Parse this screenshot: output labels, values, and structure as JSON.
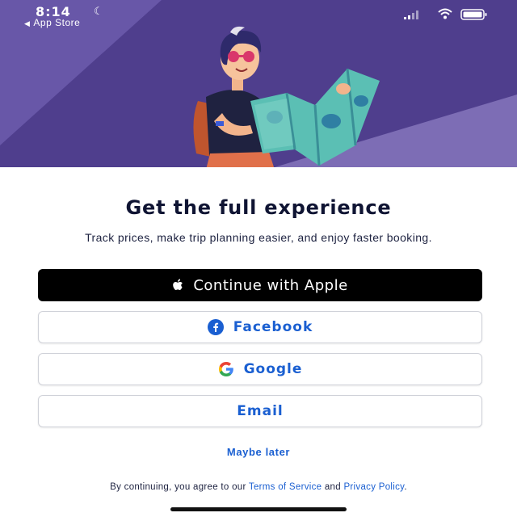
{
  "status_bar": {
    "time": "8:14",
    "moon_icon": "moon-icon",
    "back_app": "App Store",
    "icons": [
      "signal-icon",
      "wifi-icon",
      "battery-icon"
    ]
  },
  "hero": {
    "illustration": "traveler-with-map-illustration",
    "colors": {
      "background": "#4f3e8d",
      "accent_light": "#6857a8"
    }
  },
  "content": {
    "title": "Get the full experience",
    "subtitle": "Track prices, make trip planning easier, and enjoy faster booking."
  },
  "buttons": {
    "apple": {
      "label": "Continue with Apple",
      "icon": "apple-logo-icon"
    },
    "facebook": {
      "label": "Facebook",
      "icon": "facebook-logo-icon"
    },
    "google": {
      "label": "Google",
      "icon": "google-logo-icon"
    },
    "email": {
      "label": "Email"
    }
  },
  "maybe_later": "Maybe later",
  "legal": {
    "prefix": "By continuing, you agree to our ",
    "terms": "Terms of Service",
    "and": " and ",
    "privacy": "Privacy Policy",
    "suffix": "."
  },
  "colors": {
    "link": "#1a5fd1",
    "title": "#0f1433",
    "apple_button": "#000000"
  }
}
